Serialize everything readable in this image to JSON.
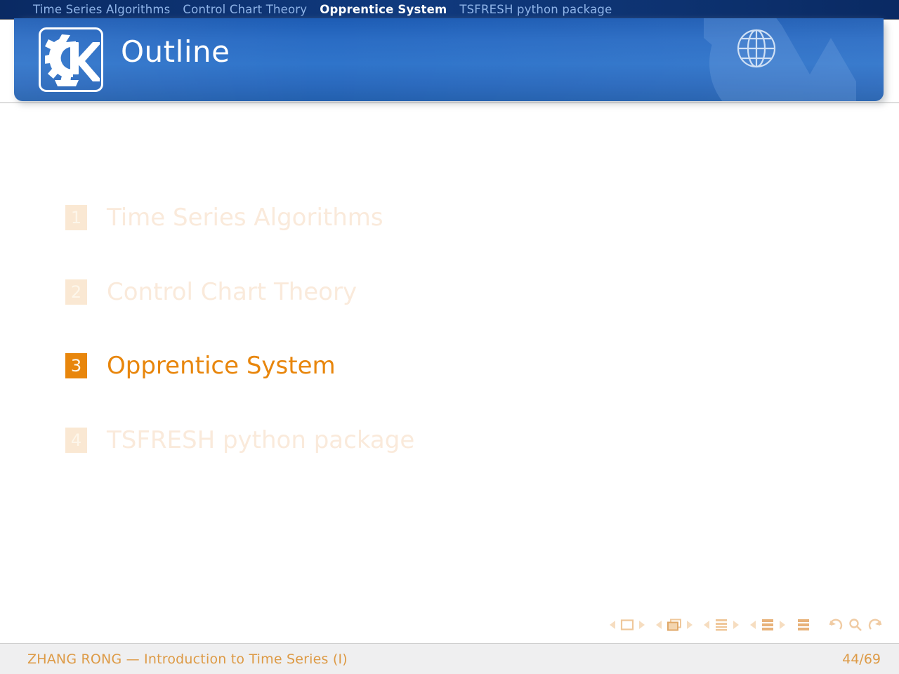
{
  "nav": {
    "items": [
      {
        "label": "Time Series Algorithms",
        "active": false
      },
      {
        "label": "Control Chart Theory",
        "active": false
      },
      {
        "label": "Opprentice System",
        "active": true
      },
      {
        "label": "TSFRESH python package",
        "active": false
      }
    ]
  },
  "header": {
    "title": "Outline",
    "logo_icon": "kde-logo-icon",
    "globe_icon": "globe-icon"
  },
  "outline": {
    "items": [
      {
        "number": "1",
        "label": "Time Series Algorithms",
        "active": false
      },
      {
        "number": "2",
        "label": "Control Chart Theory",
        "active": false
      },
      {
        "number": "3",
        "label": "Opprentice System",
        "active": true
      },
      {
        "number": "4",
        "label": "TSFRESH python package",
        "active": false
      }
    ]
  },
  "nav_symbols": {
    "groups": [
      {
        "icon": "slide-icon",
        "prev": "previous-slide-arrow",
        "next": "next-slide-arrow"
      },
      {
        "icon": "frame-icon",
        "prev": "previous-frame-arrow",
        "next": "next-frame-arrow"
      },
      {
        "icon": "subsection-icon",
        "prev": "previous-subsection-arrow",
        "next": "next-subsection-arrow"
      },
      {
        "icon": "section-icon",
        "prev": "previous-section-arrow",
        "next": "next-section-arrow"
      }
    ],
    "doc_icon": "document-icon",
    "back_icon": "go-back-icon",
    "search_icon": "search-icon",
    "forward_icon": "go-forward-icon"
  },
  "footer": {
    "author_title": "ZHANG RONG — Introduction to Time Series (I)",
    "page": "44/69"
  },
  "colors": {
    "accent_orange": "#e8860c",
    "dim_orange": "#faeadb",
    "header_blue": "#2a6cc4",
    "nav_navy": "#0d3270",
    "footer_bg": "#efeff0",
    "footer_text": "#dd9a45"
  }
}
